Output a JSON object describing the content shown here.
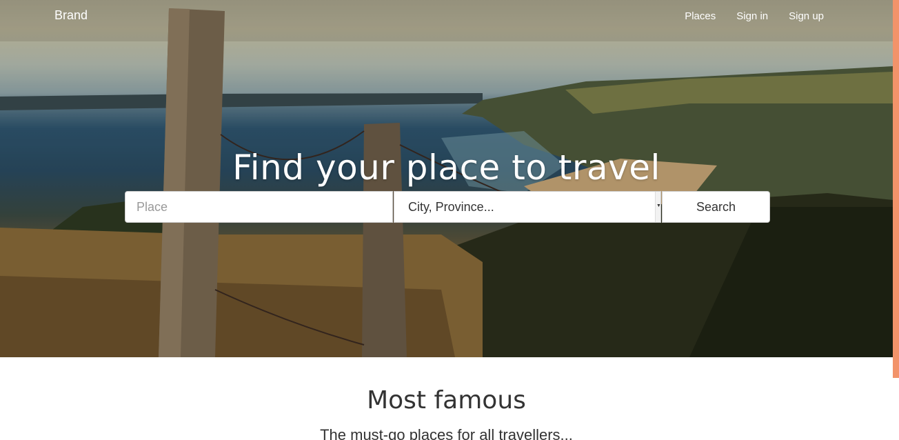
{
  "nav": {
    "brand": "Brand",
    "links": [
      "Places",
      "Sign in",
      "Sign up"
    ]
  },
  "hero": {
    "title": "Find your place to travel"
  },
  "search": {
    "place_placeholder": "Place",
    "city_value": "City, Province...",
    "button_label": "Search"
  },
  "section": {
    "title": "Most famous",
    "subtitle": "The must-go places for all travellers..."
  },
  "colors": {
    "accent_strip": "#f2936a",
    "text_dark": "#333333"
  }
}
